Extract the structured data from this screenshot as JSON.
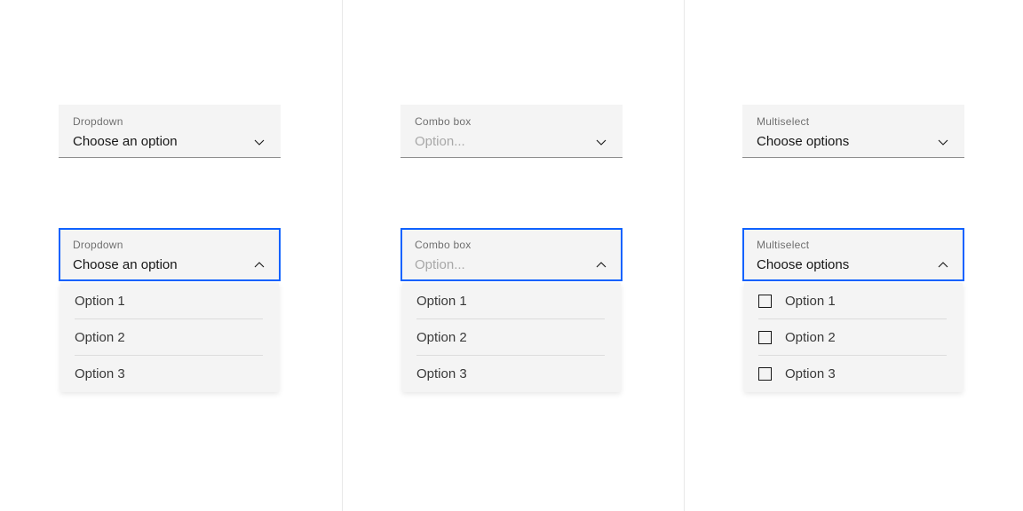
{
  "accent_color": "#0f62fe",
  "field_background": "#f4f4f4",
  "field_border_color": "#8d8d8d",
  "divider_color": "#e8e8e8",
  "icons": {
    "chevron_down": "chevron-down-icon",
    "chevron_up": "chevron-up-icon",
    "checkbox_unchecked": "checkbox-unchecked-icon"
  },
  "columns": [
    {
      "name": "dropdown",
      "closed": {
        "label": "Dropdown",
        "value": "Choose an option",
        "is_placeholder": false,
        "chevron": "chevron-down-icon"
      },
      "open": {
        "label": "Dropdown",
        "value": "Choose an option",
        "is_placeholder": false,
        "chevron": "chevron-up-icon"
      },
      "options": [
        {
          "label": "Option 1",
          "checked": false
        },
        {
          "label": "Option 2",
          "checked": false
        },
        {
          "label": "Option 3",
          "checked": false
        }
      ]
    },
    {
      "name": "combo-box",
      "closed": {
        "label": "Combo box",
        "value": "Option...",
        "is_placeholder": true,
        "chevron": "chevron-down-icon"
      },
      "open": {
        "label": "Combo box",
        "value": "Option...",
        "is_placeholder": true,
        "chevron": "chevron-up-icon"
      },
      "options": [
        {
          "label": "Option 1",
          "checked": false
        },
        {
          "label": "Option 2",
          "checked": false
        },
        {
          "label": "Option 3",
          "checked": false
        }
      ]
    },
    {
      "name": "multiselect",
      "closed": {
        "label": "Multiselect",
        "value": "Choose options",
        "is_placeholder": false,
        "chevron": "chevron-down-icon"
      },
      "open": {
        "label": "Multiselect",
        "value": "Choose options",
        "is_placeholder": false,
        "chevron": "chevron-up-icon"
      },
      "options": [
        {
          "label": "Option 1",
          "checked": false
        },
        {
          "label": "Option 2",
          "checked": false
        },
        {
          "label": "Option 3",
          "checked": false
        }
      ]
    }
  ]
}
